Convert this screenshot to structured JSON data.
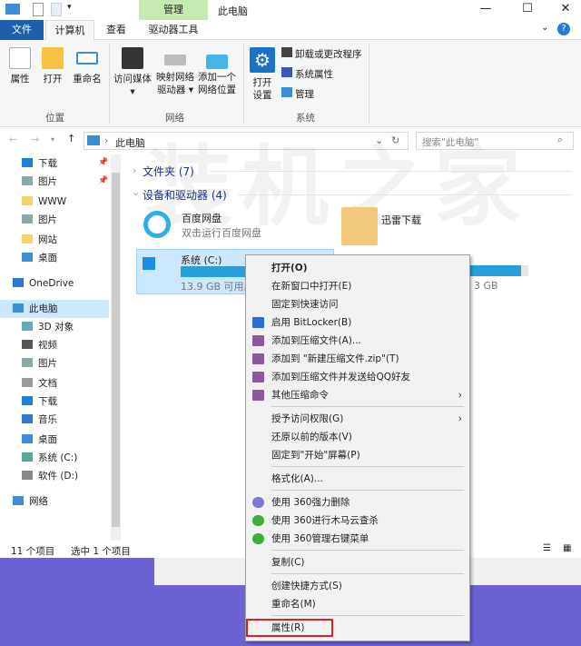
{
  "window": {
    "title": "此电脑",
    "context_tab_group": "管理",
    "minimize": "—",
    "maximize": "☐",
    "close": "✕",
    "help": "?"
  },
  "tabs": [
    {
      "label": "文件"
    },
    {
      "label": "计算机"
    },
    {
      "label": "查看"
    },
    {
      "label": "驱动器工具"
    }
  ],
  "ribbon": {
    "location": {
      "label": "位置",
      "buttons": [
        "属性",
        "打开",
        "重命名"
      ]
    },
    "network": {
      "label": "网络",
      "buttons": [
        "访问媒体",
        "映射网络驱动器",
        "添加一个网络位置"
      ]
    },
    "system": {
      "label": "系统",
      "open_settings": "打开设置",
      "small": [
        "卸载或更改程序",
        "系统属性",
        "管理"
      ]
    }
  },
  "address": {
    "path": "此电脑",
    "search_placeholder": "搜索\"此电脑\""
  },
  "sidebar": [
    {
      "label": "下载",
      "pin": true
    },
    {
      "label": "图片",
      "pin": true
    },
    {
      "label": "WWW"
    },
    {
      "label": "图片"
    },
    {
      "label": "网站"
    },
    {
      "label": "桌面"
    },
    {
      "label": "OneDrive"
    },
    {
      "label": "此电脑",
      "selected": true
    },
    {
      "label": "3D 对象"
    },
    {
      "label": "视频"
    },
    {
      "label": "图片"
    },
    {
      "label": "文档"
    },
    {
      "label": "下载"
    },
    {
      "label": "音乐"
    },
    {
      "label": "桌面"
    },
    {
      "label": "系统 (C:)"
    },
    {
      "label": "软件 (D:)"
    },
    {
      "label": "网络"
    }
  ],
  "content": {
    "folders_header": "文件夹 (7)",
    "devices_header": "设备和驱动器 (4)",
    "items": [
      {
        "name": "百度网盘",
        "sub": "双击运行百度网盘"
      },
      {
        "name": "迅雷下载"
      }
    ],
    "drive_c": {
      "name": "系统 (C:)",
      "free": "13.9 GB 可用,",
      "used_fraction": 0.75
    },
    "drive_d": {
      "free_tail": "3 GB",
      "used_fraction": 0.88
    }
  },
  "status": {
    "count": "11 个项目",
    "selected": "选中 1 个项目"
  },
  "watermark": "装机之家",
  "context_menu": [
    {
      "label": "打开(O)",
      "bold": true
    },
    {
      "label": "在新窗口中打开(E)"
    },
    {
      "label": "固定到快速访问"
    },
    {
      "label": "启用 BitLocker(B)",
      "icon": "shield"
    },
    {
      "label": "添加到压缩文件(A)...",
      "icon": "rar"
    },
    {
      "label": "添加到 \"新建压缩文件.zip\"(T)",
      "icon": "rar"
    },
    {
      "label": "添加到压缩文件并发送给QQ好友",
      "icon": "rar"
    },
    {
      "label": "其他压缩命令",
      "icon": "rar",
      "submenu": true
    },
    {
      "sep": true
    },
    {
      "label": "授予访问权限(G)",
      "submenu": true
    },
    {
      "label": "还原以前的版本(V)"
    },
    {
      "label": "固定到\"开始\"屏幕(P)"
    },
    {
      "sep": true
    },
    {
      "label": "格式化(A)..."
    },
    {
      "sep": true
    },
    {
      "label": "使用 360强力删除",
      "icon": "360del"
    },
    {
      "label": "使用 360进行木马云查杀",
      "icon": "360"
    },
    {
      "label": "使用 360管理右键菜单",
      "icon": "360"
    },
    {
      "sep": true
    },
    {
      "label": "复制(C)"
    },
    {
      "sep": true
    },
    {
      "label": "创建快捷方式(S)"
    },
    {
      "label": "重命名(M)"
    },
    {
      "sep": true
    },
    {
      "label": "属性(R)",
      "highlighted": true
    }
  ],
  "colors": {
    "file_tab": "#1b5fad",
    "manage": "#c6ebb0",
    "accent": "#26a0da",
    "highlight_box": "#e02020",
    "desktop": "#6d62d2"
  }
}
